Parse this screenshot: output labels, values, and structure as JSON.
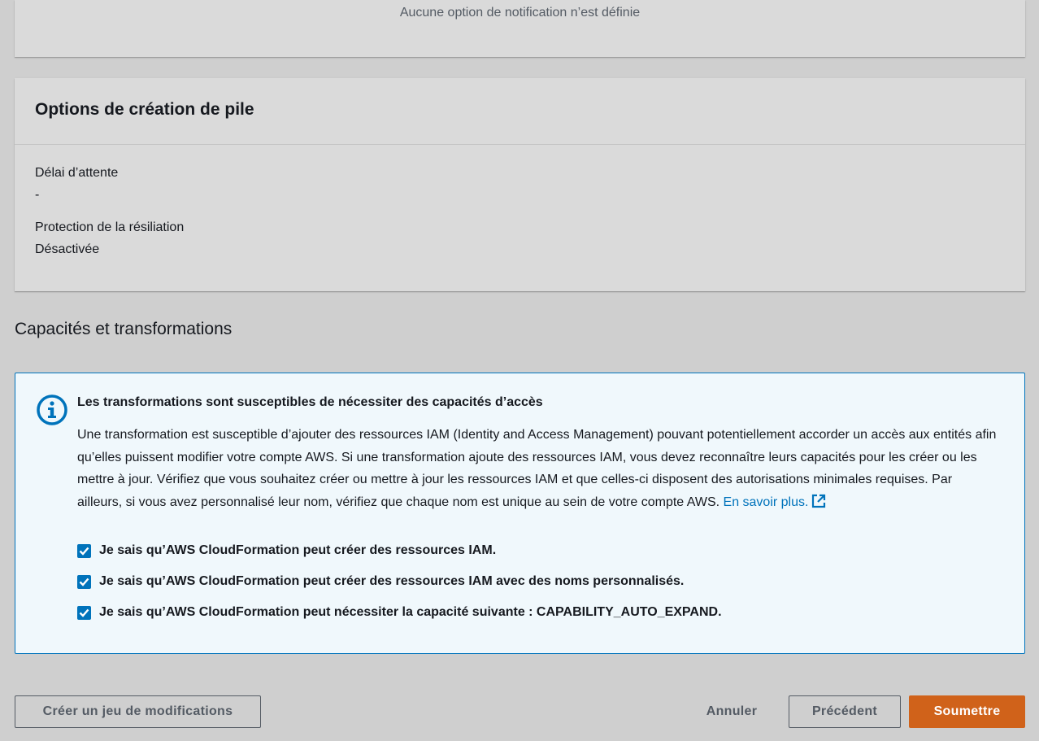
{
  "notifications": {
    "empty_text": "Aucune option de notification n’est définie"
  },
  "stack_options": {
    "title": "Options de création de pile",
    "fields": [
      {
        "label": "Délai d’attente",
        "value": "-"
      },
      {
        "label": "Protection de la résiliation",
        "value": "Désactivée"
      }
    ]
  },
  "capabilities": {
    "section_title": "Capacités et transformations",
    "alert": {
      "title": "Les transformations sont susceptibles de nécessiter des capacités d’accès",
      "body": "Une transformation est susceptible d’ajouter des ressources IAM (Identity and Access Management) pouvant potentiellement accorder un accès aux entités afin qu’elles puissent modifier votre compte AWS. Si une transformation ajoute des ressources IAM, vous devez reconnaître leurs capacités pour les créer ou les mettre à jour. Vérifiez que vous souhaitez créer ou mettre à jour les ressources IAM et que celles-ci disposent des autorisations minimales requises. Par ailleurs, si vous avez personnalisé leur nom, vérifiez que chaque nom est unique au sein de votre compte AWS.",
      "link_text": "En savoir plus.",
      "icon": "info-icon",
      "color": "#0073bb"
    },
    "checkboxes": [
      {
        "label": "Je sais qu’AWS CloudFormation peut créer des ressources IAM.",
        "checked": true
      },
      {
        "label": "Je sais qu’AWS CloudFormation peut créer des ressources IAM avec des noms personnalisés.",
        "checked": true
      },
      {
        "label": "Je sais qu’AWS CloudFormation peut nécessiter la capacité suivante : CAPABILITY_AUTO_EXPAND.",
        "checked": true
      }
    ]
  },
  "footer": {
    "create_changeset": "Créer un jeu de modifications",
    "cancel": "Annuler",
    "previous": "Précédent",
    "submit": "Soumettre",
    "primary_color": "#d0621a"
  }
}
